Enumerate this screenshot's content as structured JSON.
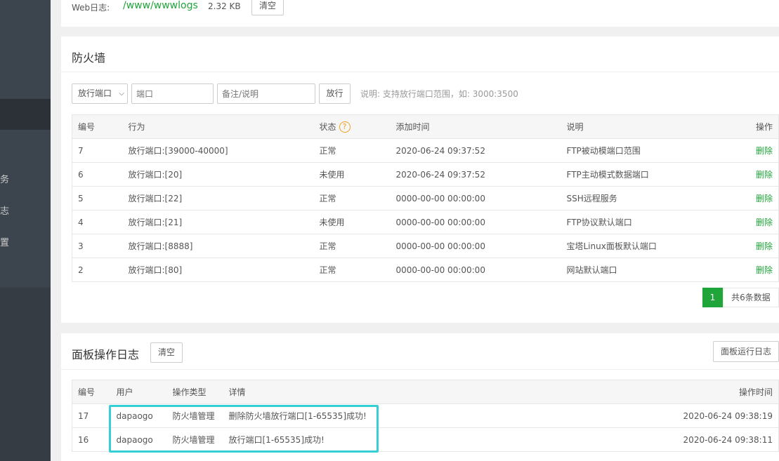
{
  "sidebar": {
    "items": [
      {
        "label": "务"
      },
      {
        "label": "志"
      },
      {
        "label": "置"
      }
    ]
  },
  "weblog": {
    "label": "Web日志:",
    "path": "/www/wwwlogs",
    "size": "2.32 KB",
    "clear_label": "清空"
  },
  "firewall": {
    "title": "防火墙",
    "select_value": "放行端口",
    "port_placeholder": "端口",
    "note_placeholder": "备注/说明",
    "submit_label": "放行",
    "hint": "说明: 支持放行端口范围，如: 3000:3500",
    "columns": [
      "编号",
      "行为",
      "状态",
      "添加时间",
      "说明",
      "操作"
    ],
    "rows": [
      {
        "id": "7",
        "action": "放行端口:[39000-40000]",
        "status": "正常",
        "time": "2020-06-24 09:37:52",
        "desc": "FTP被动模端口范围",
        "op": "删除"
      },
      {
        "id": "6",
        "action": "放行端口:[20]",
        "status": "未使用",
        "time": "2020-06-24 09:37:52",
        "desc": "FTP主动模式数据端口",
        "op": "删除"
      },
      {
        "id": "5",
        "action": "放行端口:[22]",
        "status": "正常",
        "time": "0000-00-00 00:00:00",
        "desc": "SSH远程服务",
        "op": "删除"
      },
      {
        "id": "4",
        "action": "放行端口:[21]",
        "status": "未使用",
        "time": "0000-00-00 00:00:00",
        "desc": "FTP协议默认端口",
        "op": "删除"
      },
      {
        "id": "3",
        "action": "放行端口:[8888]",
        "status": "正常",
        "time": "0000-00-00 00:00:00",
        "desc": "宝塔Linux面板默认端口",
        "op": "删除"
      },
      {
        "id": "2",
        "action": "放行端口:[80]",
        "status": "正常",
        "time": "0000-00-00 00:00:00",
        "desc": "网站默认端口",
        "op": "删除"
      }
    ],
    "pager": {
      "current": "1",
      "total": "共6条数据"
    }
  },
  "oplog": {
    "title": "面板操作日志",
    "clear_label": "清空",
    "run_log_label": "面板运行日志",
    "columns": [
      "编号",
      "用户",
      "操作类型",
      "详情",
      "操作时间"
    ],
    "rows": [
      {
        "id": "17",
        "user": "dapaogo",
        "type": "防火墙管理",
        "detail": "删除防火墙放行端口[1-65535]成功!",
        "time": "2020-06-24 09:38:19"
      },
      {
        "id": "16",
        "user": "dapaogo",
        "type": "防火墙管理",
        "detail": "放行端口[1-65535]成功!",
        "time": "2020-06-24 09:38:11"
      }
    ]
  },
  "colors": {
    "accent": "#20a53a",
    "highlight": "#36cfd6",
    "sidebar": "#3c444d"
  }
}
